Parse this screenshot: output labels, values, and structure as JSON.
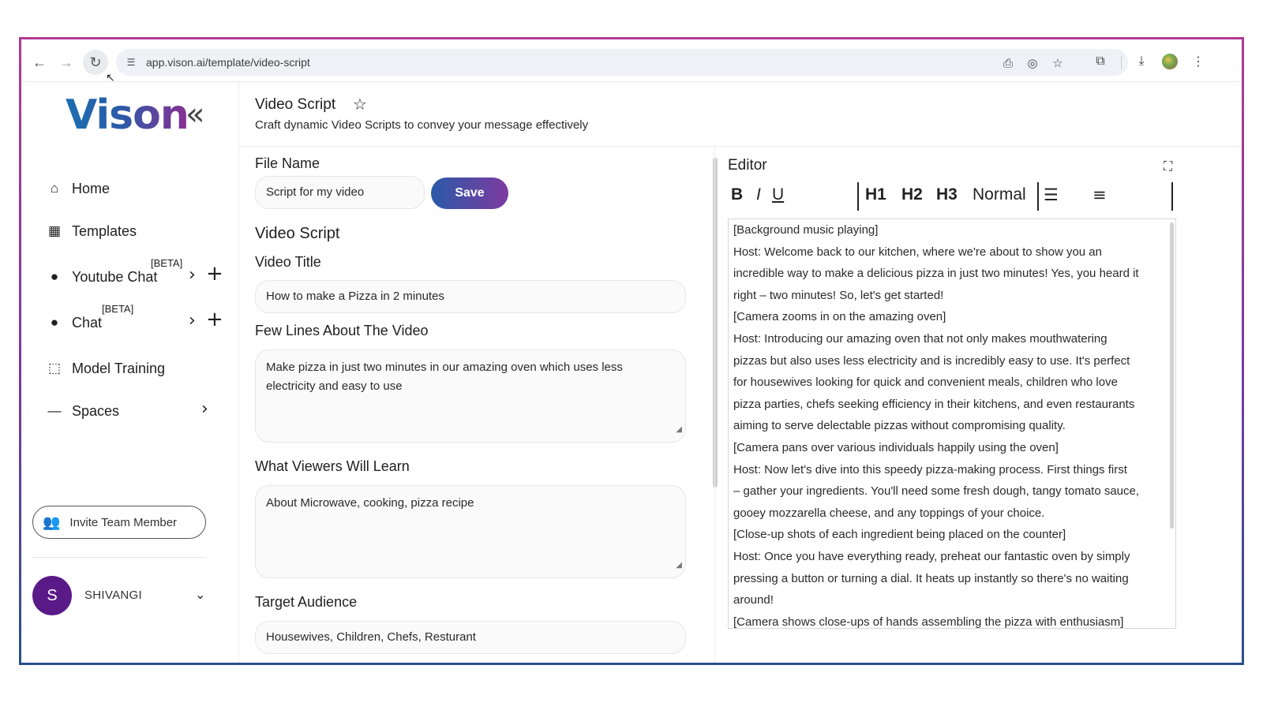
{
  "browser": {
    "url": "app.vison.ai/template/video-script"
  },
  "sidebar": {
    "logo": "Vison",
    "items": [
      {
        "label": "Home",
        "icon": "home-icon"
      },
      {
        "label": "Templates",
        "icon": "templates-icon"
      },
      {
        "label": "Youtube Chat",
        "icon": "chat-bubble-icon",
        "badge": "[BETA]"
      },
      {
        "label": "Chat",
        "icon": "chat-bubble-icon",
        "badge": "[BETA]"
      },
      {
        "label": "Model Training",
        "icon": "model-training-icon"
      },
      {
        "label": "Spaces",
        "icon": "minus-icon"
      }
    ],
    "invite_label": "Invite Team Member",
    "user_initial": "S",
    "user_name": "SHIVANGI"
  },
  "header": {
    "title": "Video Script",
    "subtitle": "Craft dynamic Video Scripts to convey your message effectively"
  },
  "form": {
    "file_name_label": "File Name",
    "file_name_value": "Script for my video",
    "save_label": "Save",
    "section_title": "Video Script",
    "video_title_label": "Video Title",
    "video_title_value": "How to make a Pizza in 2 minutes",
    "few_lines_label": "Few Lines About The Video",
    "few_lines_value": "Make pizza in just two minutes in our amazing oven which uses less electricity and easy to use",
    "learn_label": "What Viewers Will Learn",
    "learn_value": "About Microwave, cooking, pizza recipe",
    "audience_label": "Target Audience",
    "audience_value": "Housewives, Children, Chefs, Resturant"
  },
  "editor": {
    "title": "Editor",
    "toolbar": {
      "bold": "B",
      "italic": "I",
      "underline": "U",
      "h1": "H1",
      "h2": "H2",
      "h3": "H3",
      "normal": "Normal"
    },
    "lines": [
      "[Background music playing]",
      "Host: Welcome back to our kitchen, where we're about to show you an",
      "incredible way to make a delicious pizza in just two minutes! Yes, you heard it",
      "right – two minutes! So, let's get started!",
      "[Camera zooms in on the amazing oven]",
      "Host: Introducing our amazing oven that not only makes mouthwatering",
      "pizzas but also uses less electricity and is incredibly easy to use. It's perfect",
      "for housewives looking for quick and convenient meals, children who love",
      "pizza parties, chefs seeking efficiency in their kitchens, and even restaurants",
      "aiming to serve delectable pizzas without compromising quality.",
      "[Camera pans over various individuals happily using the oven]",
      "Host: Now let's dive into this speedy pizza-making process. First things first",
      "– gather your ingredients. You'll need some fresh dough, tangy tomato sauce,",
      "gooey mozzarella cheese, and any toppings of your choice.",
      "[Close-up shots of each ingredient being placed on the counter]",
      "Host: Once you have everything ready, preheat our fantastic oven by simply",
      "pressing a button or turning a dial. It heats up instantly so there's no waiting",
      "around!",
      "[Camera shows close-ups of hands assembling the pizza with enthusiasm]"
    ]
  },
  "colors": {
    "accent_start": "#2a5aa8",
    "accent_end": "#7e3aa0",
    "avatar": "#5a1a88"
  }
}
